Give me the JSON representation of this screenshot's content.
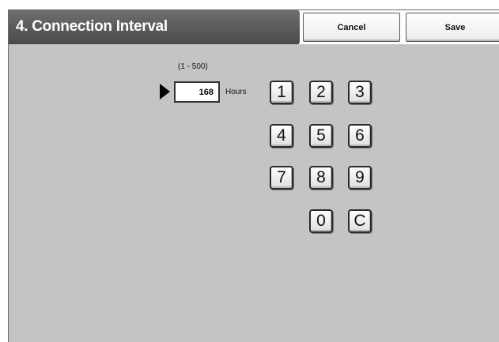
{
  "header": {
    "title": "4. Connection Interval",
    "cancel_label": "Cancel",
    "save_label": "Save"
  },
  "entry": {
    "range": "(1 - 500)",
    "value": "168",
    "unit": "Hours"
  },
  "keypad": {
    "k1": "1",
    "k2": "2",
    "k3": "3",
    "k4": "4",
    "k5": "5",
    "k6": "6",
    "k7": "7",
    "k8": "8",
    "k9": "9",
    "k0": "0",
    "clear": "C"
  }
}
